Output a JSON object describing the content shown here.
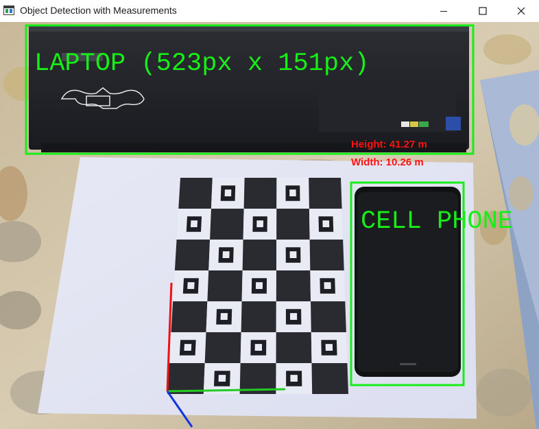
{
  "window": {
    "title": "Object Detection with Measurements",
    "controls": {
      "minimize": "minimize-icon",
      "maximize": "maximize-icon",
      "close": "close-icon"
    }
  },
  "detections": [
    {
      "label": "LAPTOP (523px x 151px)"
    },
    {
      "label": "CELL PHONE"
    }
  ],
  "measurements": {
    "height": "Height: 41.27 m",
    "width": "Width: 10.26 m"
  },
  "colors": {
    "box": "#17ee17",
    "measurement_text": "#ff1212",
    "axis_x": "#22cc22",
    "axis_y": "#ee1111",
    "axis_z": "#1133dd"
  }
}
